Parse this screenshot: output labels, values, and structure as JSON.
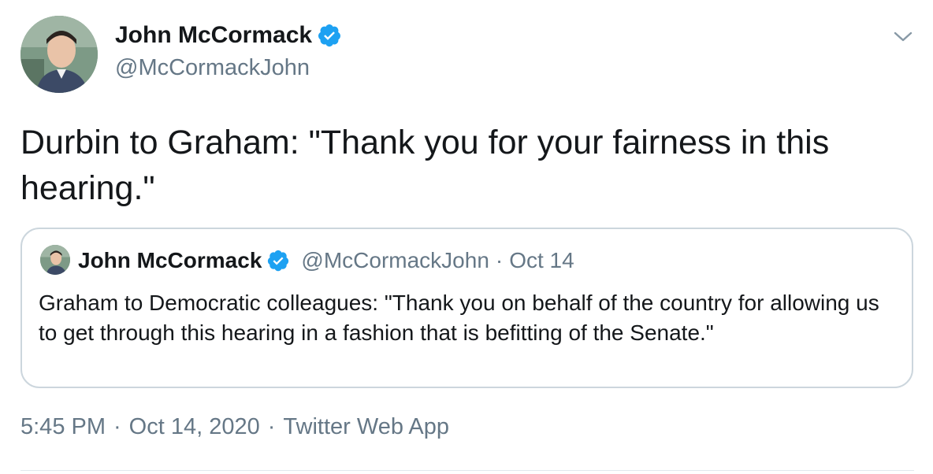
{
  "author": {
    "name": "John McCormack",
    "handle": "@McCormackJohn"
  },
  "tweet": {
    "text": "Durbin to Graham: \"Thank you for your fairness in this hearing.\"",
    "time": "5:45 PM",
    "date": "Oct 14, 2020",
    "source": "Twitter Web App",
    "separator": "·"
  },
  "quoted_tweet": {
    "name": "John McCormack",
    "handle": "@McCormackJohn",
    "separator": "·",
    "date": "Oct 14",
    "text": "Graham to Democratic colleagues: \"Thank you on behalf of the country for allowing us to get through this hearing in a fashion that is befitting of the Senate.\""
  },
  "icons": {
    "verified": "verified-badge-icon",
    "menu": "chevron-down-icon"
  },
  "colors": {
    "verified_blue": "#1da1f2",
    "secondary_text": "#657786",
    "border": "#ccd6dd"
  }
}
